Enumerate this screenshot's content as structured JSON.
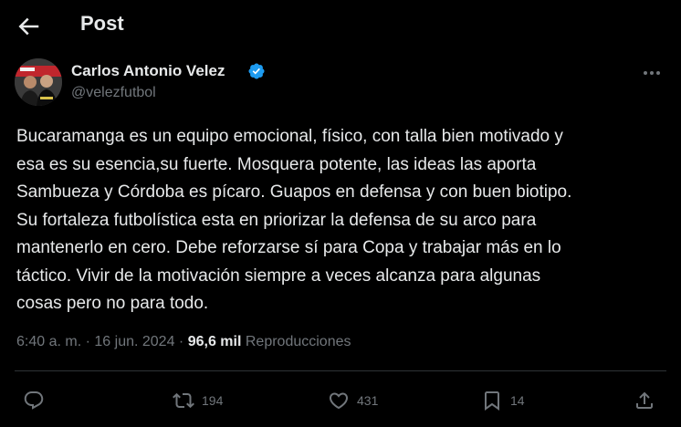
{
  "header": {
    "title": "Post",
    "back_icon": "arrow-left-icon"
  },
  "author": {
    "name": "Carlos Antonio Velez",
    "handle": "@velezfutbol",
    "verified": true,
    "verified_color": "#1d9bf0"
  },
  "post": {
    "text": "Bucaramanga es un equipo emocional, físico, con talla bien motivado y\nesa es su esencia,su fuerte. Mosquera potente, las ideas las aporta\nSambueza y Córdoba es pícaro. Guapos en defensa y con buen biotipo.\nSu fortaleza futbolística esta en priorizar la defensa de su arco para\nmantenerlo en cero. Debe reforzarse sí para Copa y trabajar más en lo\ntáctico. Vivir de la motivación siempre a veces alcanza para algunas\ncosas pero no para todo.",
    "time": "6:40 a. m.",
    "separator": "·",
    "date": "16 jun. 2024",
    "views_count": "96,6 mil",
    "views_label": "Reproducciones"
  },
  "actions": {
    "reply": {
      "icon": "reply-icon",
      "count": ""
    },
    "retweet": {
      "icon": "retweet-icon",
      "count": "194"
    },
    "like": {
      "icon": "heart-icon",
      "count": "431"
    },
    "bookmark": {
      "icon": "bookmark-icon",
      "count": "14"
    },
    "share": {
      "icon": "share-icon",
      "count": ""
    }
  },
  "colors": {
    "background": "#000000",
    "text": "#e7e9ea",
    "muted": "#71767b",
    "divider": "#2f3336"
  }
}
